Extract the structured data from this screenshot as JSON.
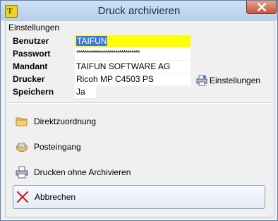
{
  "window": {
    "title": "Druck archivieren",
    "app_icon_letter": "T"
  },
  "settings": {
    "group_label": "Einstellungen",
    "rows": [
      {
        "label": "Benutzer",
        "value": "TAIFUN"
      },
      {
        "label": "Passwort",
        "value": "*******************************"
      },
      {
        "label": "Mandant",
        "value": "TAIFUN SOFTWARE AG"
      },
      {
        "label": "Drucker",
        "value": "Ricoh MP C4503 PS"
      },
      {
        "label": "Speichern",
        "value": "Ja"
      }
    ],
    "settings_button_label": "Einstellungen"
  },
  "actions": {
    "direct": "Direktzuordnung",
    "inbox": "Posteingang",
    "print_no_archive": "Drucken ohne Archivieren",
    "cancel": "Abbrechen"
  },
  "colors": {
    "user_field_bg": "#ffff00",
    "selection": "#3b78d8",
    "close_red": "#c7533a"
  },
  "icons": [
    "app-logo-icon",
    "close-icon",
    "printer-settings-icon",
    "folder-icon",
    "inbox-icon",
    "printer-icon",
    "cancel-x-icon"
  ]
}
